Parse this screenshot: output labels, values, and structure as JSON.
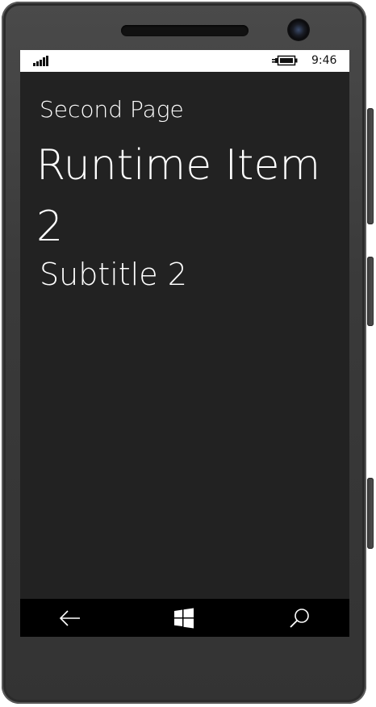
{
  "status_bar": {
    "time": "9:46",
    "signal_icon": "signal-bars-icon",
    "battery_icon": "battery-charging-icon"
  },
  "page": {
    "header": "Second Page",
    "title": "Runtime Item 2",
    "subtitle": "Subtitle 2"
  },
  "nav_bar": {
    "back_icon": "back-arrow-icon",
    "start_icon": "windows-logo-icon",
    "search_icon": "search-icon"
  },
  "colors": {
    "background": "#222222",
    "text": "#ffffff",
    "status_bar": "#ffffff",
    "nav_bar": "#000000"
  }
}
